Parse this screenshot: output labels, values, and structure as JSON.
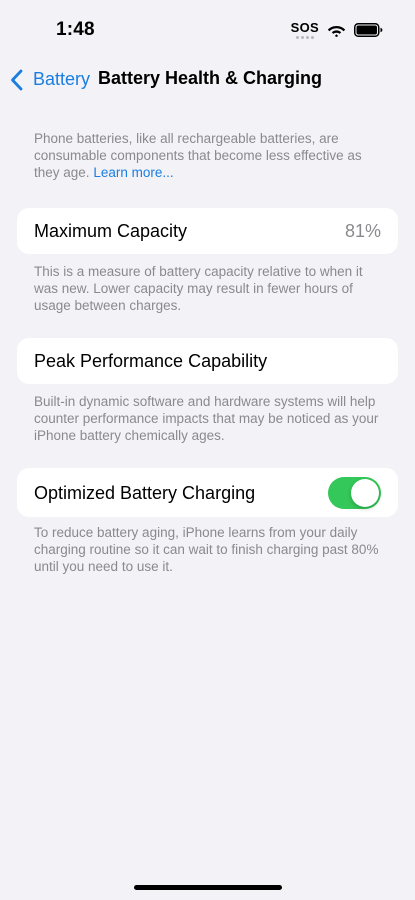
{
  "status_bar": {
    "time": "1:48",
    "sos_label": "SOS",
    "icons": [
      "sos-indicator",
      "wifi-icon",
      "battery-icon"
    ]
  },
  "nav": {
    "back_label": "Battery",
    "title": "Battery Health & Charging",
    "back_icon": "chevron-left-icon"
  },
  "intro": {
    "text": "Phone batteries, like all rechargeable batteries, are consumable components that become less effective as they age.",
    "link": "Learn more..."
  },
  "max_capacity": {
    "label": "Maximum Capacity",
    "value": "81%",
    "footnote": "This is a measure of battery capacity relative to when it was new. Lower capacity may result in fewer hours of usage between charges."
  },
  "peak_performance": {
    "label": "Peak Performance Capability",
    "footnote": "Built-in dynamic software and hardware systems will help counter performance impacts that may be noticed as your iPhone battery chemically ages."
  },
  "optimized_charging": {
    "label": "Optimized Battery Charging",
    "enabled": true,
    "footnote": "To reduce battery aging, iPhone learns from your daily charging routine so it can wait to finish charging past 80% until you need to use it."
  },
  "colors": {
    "background": "#f2f2f7",
    "accent": "#1a7ee0",
    "toggle_on": "#34c759",
    "secondary_text": "#8a8a8e"
  }
}
